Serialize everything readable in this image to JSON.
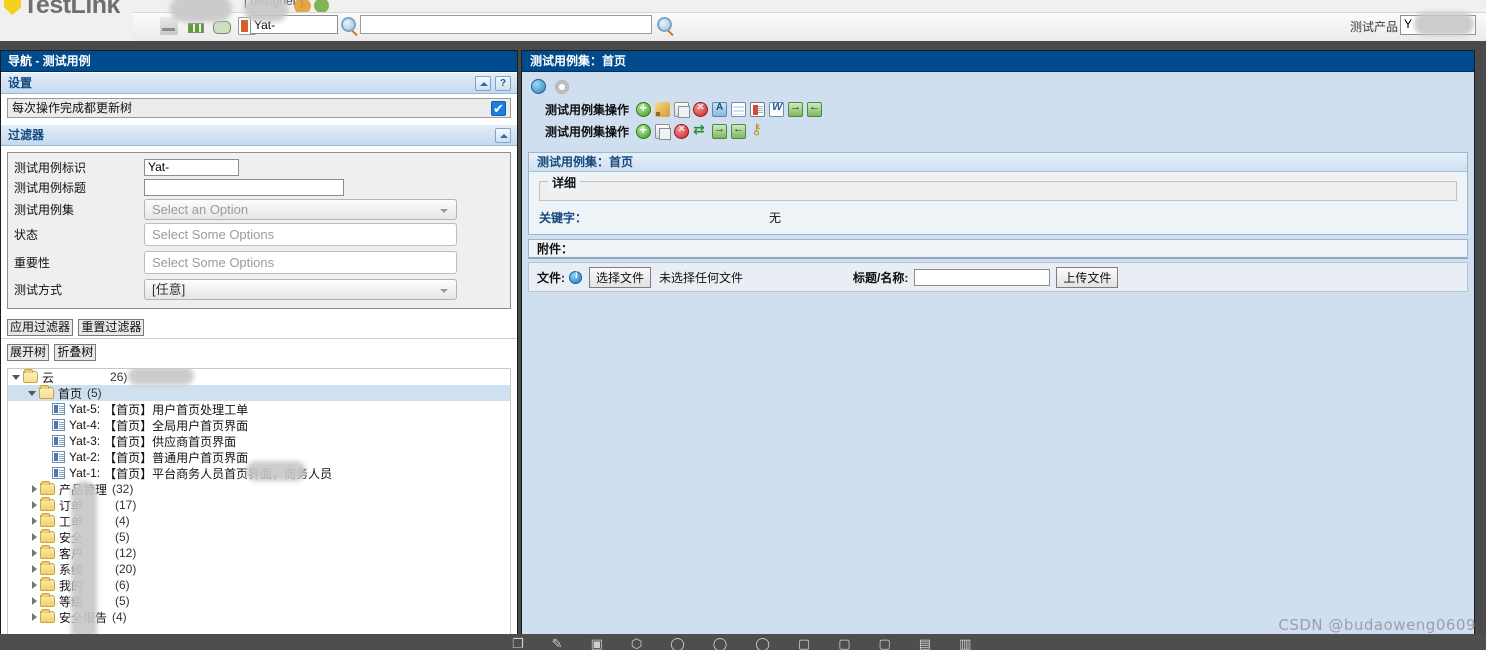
{
  "app": {
    "brand": "TestLink",
    "designer_text": "[ designer ]",
    "product_label": "测试产品",
    "product_value": "Y"
  },
  "toolbar": {
    "quick_search_value": "Yat-",
    "big_search_value": "",
    "icons": [
      "export-icon",
      "chart-icon",
      "map-icon",
      "report-icon",
      "search-icon",
      "search-icon"
    ]
  },
  "left_panel": {
    "title": "导航 - 测试用例",
    "settings": {
      "header": "设置",
      "collapse_label": "",
      "help_label": "?",
      "option_label": "每次操作完成都更新树",
      "checked": true
    },
    "filter": {
      "header": "过滤器",
      "fields": [
        {
          "label": "测试用例标识",
          "type": "text",
          "value": "Yat-",
          "placeholder": ""
        },
        {
          "label": "测试用例标题",
          "type": "text",
          "value": "",
          "placeholder": ""
        },
        {
          "label": "测试用例集",
          "type": "select",
          "value": "Select an Option"
        },
        {
          "label": "状态",
          "type": "multiselect",
          "value": "Select Some Options"
        },
        {
          "label": "重要性",
          "type": "multiselect",
          "value": "Select Some Options"
        },
        {
          "label": "测试方式",
          "type": "select",
          "value": "[任意]"
        }
      ],
      "apply_button": "应用过滤器",
      "reset_button": "重置过滤器"
    },
    "tree_controls": {
      "expand_button": "展开树",
      "collapse_button": "折叠树"
    },
    "tree": {
      "root": {
        "label": "云",
        "count": "26)",
        "expanded": true
      },
      "selected_folder": {
        "label": "首页",
        "count": "(5)",
        "expanded": true
      },
      "testcases": [
        {
          "id": "Yat-5:",
          "title": "【首页】用户首页处理工单"
        },
        {
          "id": "Yat-4:",
          "title": "【首页】全局用户首页界面"
        },
        {
          "id": "Yat-3:",
          "title": "【首页】供应商首页界面"
        },
        {
          "id": "Yat-2:",
          "title": "【首页】普通用户首页界面"
        },
        {
          "id": "Yat-1:",
          "title": "【首页】平台商务人员首页界面，商务人员"
        }
      ],
      "folders": [
        {
          "label": "产品管理",
          "count": "(32)"
        },
        {
          "label": "订单",
          "count": "(17)"
        },
        {
          "label": "工单",
          "count": "(4)"
        },
        {
          "label": "安全",
          "count": "(5)"
        },
        {
          "label": "客户",
          "count": "(12)"
        },
        {
          "label": "系统",
          "count": "(20)"
        },
        {
          "label": "我的",
          "count": "(6)"
        },
        {
          "label": "等级",
          "count": "(5)"
        },
        {
          "label": "安全报告",
          "count": "(4)"
        }
      ]
    }
  },
  "right_panel": {
    "title": "测试用例集：首页",
    "actions_row1": {
      "label": "测试用例集操作",
      "icons": [
        "add-icon",
        "edit-icon",
        "copy-icon",
        "delete-icon",
        "move-icon",
        "grid-icon",
        "doc-icon",
        "word-icon",
        "import-icon",
        "export-icon"
      ]
    },
    "actions_row2": {
      "label": "测试用例集操作",
      "icons": [
        "add-icon",
        "copy-icon",
        "delete-icon",
        "shuffle-icon",
        "import-icon",
        "export-icon",
        "key-icon"
      ]
    },
    "detail": {
      "header": "测试用例集：首页",
      "legend": "详细",
      "body": "",
      "keyword_label": "关键字：",
      "keyword_value": "无"
    },
    "attachments": {
      "header": "附件：",
      "file_label": "文件:",
      "choose_button": "选择文件",
      "no_file_text": "未选择任何文件",
      "title_label": "标题/名称:",
      "title_value": "",
      "upload_button": "上传文件"
    }
  },
  "watermark": "CSDN @budaoweng0609"
}
